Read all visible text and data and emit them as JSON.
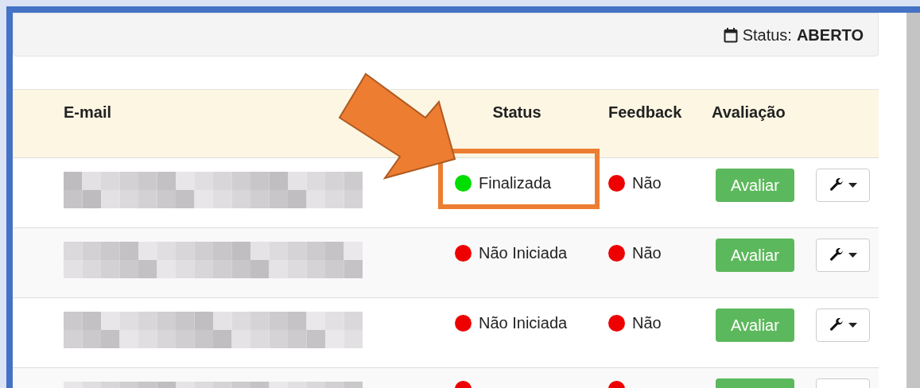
{
  "panel": {
    "status_label": "Status:",
    "status_value": "ABERTO"
  },
  "table": {
    "columns": [
      "E-mail",
      "Status",
      "Feedback",
      "Avaliação"
    ],
    "rows": [
      {
        "status": {
          "label": "Finalizada",
          "color": "#00dd00"
        },
        "feedback": {
          "label": "Não",
          "color": "#ee0000"
        },
        "action": "Avaliar"
      },
      {
        "status": {
          "label": "Não Iniciada",
          "color": "#ee0000"
        },
        "feedback": {
          "label": "Não",
          "color": "#ee0000"
        },
        "action": "Avaliar"
      },
      {
        "status": {
          "label": "Não Iniciada",
          "color": "#ee0000"
        },
        "feedback": {
          "label": "Não",
          "color": "#ee0000"
        },
        "action": "Avaliar"
      },
      {
        "status": {
          "color": "#ee0000"
        },
        "feedback": {
          "color": "#ee0000"
        }
      }
    ]
  }
}
